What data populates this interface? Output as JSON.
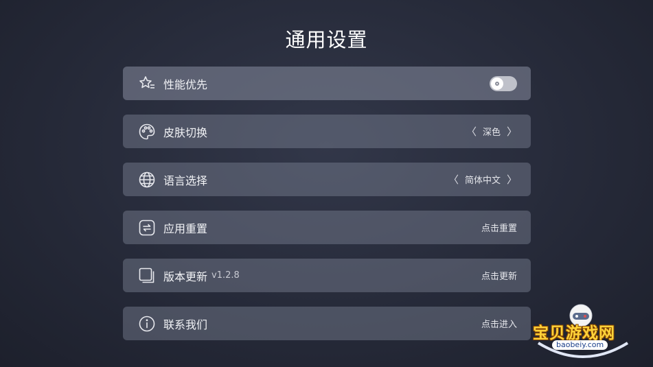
{
  "title": "通用设置",
  "settings": {
    "performance": {
      "label": "性能优先",
      "icon": "star-list-icon",
      "toggle_on": false
    },
    "skin": {
      "label": "皮肤切换",
      "icon": "palette-icon",
      "value": "深色"
    },
    "language": {
      "label": "语言选择",
      "icon": "globe-icon",
      "value": "简体中文"
    },
    "reset": {
      "label": "应用重置",
      "icon": "refresh-icon",
      "action": "点击重置"
    },
    "update": {
      "label": "版本更新",
      "version": "v1.2.8",
      "icon": "copy-icon",
      "action": "点击更新"
    },
    "contact": {
      "label": "联系我们",
      "icon": "info-icon",
      "action": "点击进入"
    }
  },
  "chevrons": {
    "left": "〈",
    "right": "〉"
  },
  "watermark": {
    "text": "宝贝游戏网",
    "url": "baobeiy.com"
  },
  "colors": {
    "accent": "#ffd33a",
    "panel": "#6c7080"
  }
}
